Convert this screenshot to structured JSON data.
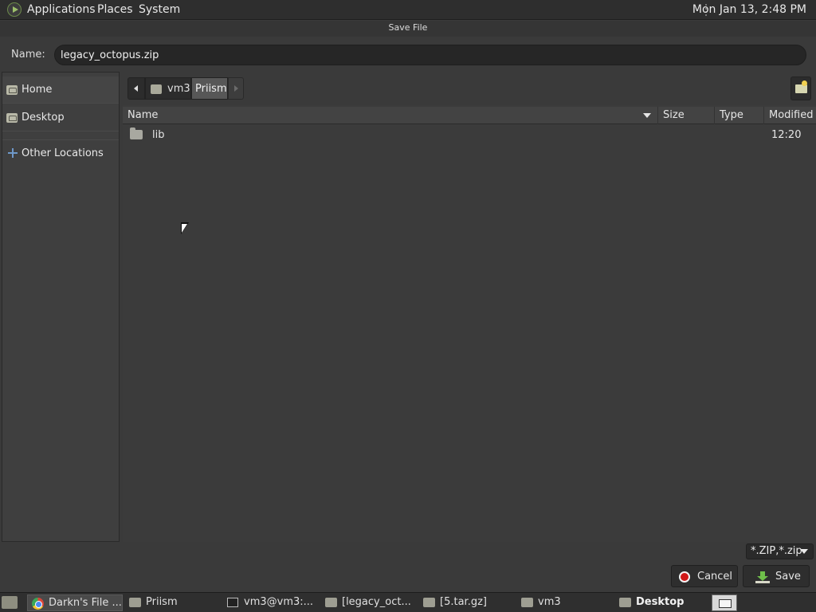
{
  "top_panel": {
    "menus": [
      "Applications",
      "Places",
      "System"
    ],
    "clock": "Mon Jan 13,  2:48 PM"
  },
  "dialog": {
    "title": "Save File",
    "name_label": "Name:",
    "name_value": "legacy_octopus.zip"
  },
  "sidebar": {
    "items": [
      {
        "label": "Home",
        "icon": "home-folder-icon"
      },
      {
        "label": "Desktop",
        "icon": "desktop-folder-icon"
      },
      {
        "label": "Other Locations",
        "icon": "plus-network-icon"
      }
    ]
  },
  "pathbar": {
    "segments": [
      "vm3",
      "Priism"
    ]
  },
  "file_list": {
    "columns": [
      "Name",
      "Size",
      "Type",
      "Modified"
    ],
    "rows": [
      {
        "name": "lib",
        "size": "",
        "type": "",
        "modified": "12:20"
      }
    ]
  },
  "actions": {
    "filter": "*.ZIP,*.zip",
    "cancel": "Cancel",
    "save": "Save"
  },
  "taskbar": {
    "tasks": [
      "Darkn's File ...",
      "Priism",
      "vm3@vm3:...",
      "[legacy_oct...",
      "[5.tar.gz]",
      "vm3",
      "Desktop"
    ]
  }
}
